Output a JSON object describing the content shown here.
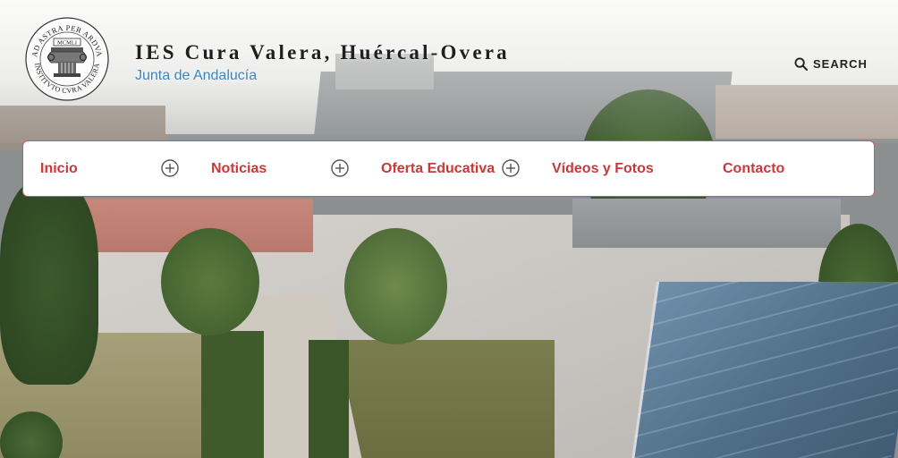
{
  "site": {
    "title": "IES Cura Valera, Huércal-Overa",
    "subtitle": "Junta de Andalucía"
  },
  "logo": {
    "motto_top": "AD ASTRA PER ARDVA",
    "motto_bottom": "INSTITVTO CVRA VALERA",
    "year": "MCMLI"
  },
  "search": {
    "label": "SEARCH",
    "icon": "search-icon"
  },
  "nav": {
    "items": [
      {
        "label": "Inicio",
        "has_submenu": true
      },
      {
        "label": "Noticias",
        "has_submenu": true
      },
      {
        "label": "Oferta Educativa",
        "has_submenu": true
      },
      {
        "label": "Vídeos y Fotos",
        "has_submenu": false
      },
      {
        "label": "Contacto",
        "has_submenu": false
      }
    ]
  },
  "colors": {
    "accent": "#c9393a",
    "subtitle": "#3a87c7",
    "title": "#1f1f1f",
    "nav_background": "#ffffff"
  },
  "hero": {
    "image": "aerial view of school courtyard"
  }
}
